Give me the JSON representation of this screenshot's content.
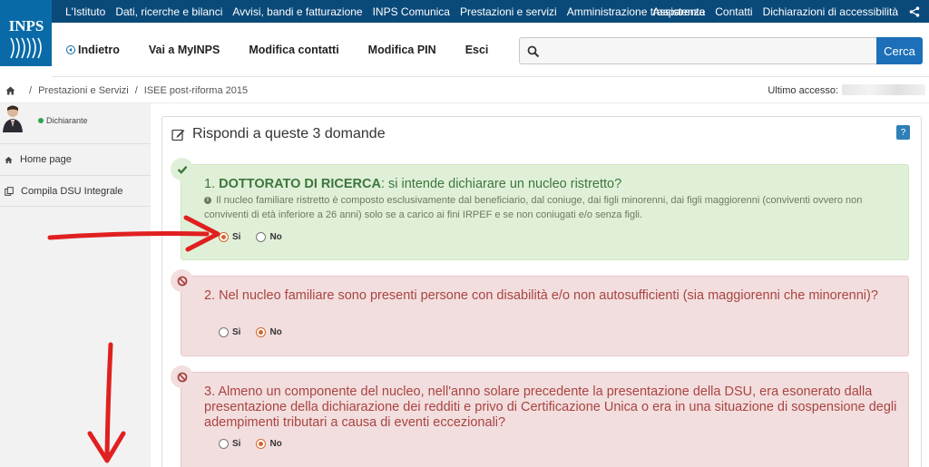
{
  "topbar": {
    "links": [
      "L'Istituto",
      "Dati, ricerche e bilanci",
      "Avvisi, bandi e fatturazione",
      "INPS Comunica",
      "Prestazioni e servizi",
      "Amministrazione trasparente"
    ],
    "right_links": [
      "Assistenza",
      "Contatti",
      "Dichiarazioni di accessibilità"
    ]
  },
  "logo": {
    "text": "INPS"
  },
  "nav": {
    "back": "Indietro",
    "myinps": "Vai a MyINPS",
    "modifica_contatti": "Modifica contatti",
    "modifica_pin": "Modifica PIN",
    "esci": "Esci"
  },
  "search": {
    "value": "",
    "button": "Cerca"
  },
  "breadcrumb": {
    "items": [
      "Prestazioni e Servizi",
      "ISEE post-riforma 2015"
    ],
    "last_access_label": "Ultimo accesso:"
  },
  "sidebar": {
    "status": "Dichiarante",
    "items": [
      "Home page",
      "Compila DSU Integrale"
    ]
  },
  "panel": {
    "title": "Rispondi a queste 3 domande",
    "help": "?"
  },
  "questions": [
    {
      "number": "1.",
      "strong": "DOTTORATO DI RICERCA",
      "text": ": si intende dichiarare un nucleo ristretto?",
      "note": "Il nucleo familiare ristretto è composto esclusivamente dal beneficiario, dal coniuge, dai figli minorenni, dai figli maggiorenni (conviventi ovvero non conviventi di età inferiore a 26 anni) solo se a carico ai fini IRPEF e se non coniugati e/o senza figli.",
      "options": [
        "Si",
        "No"
      ],
      "selected": "Si",
      "status": "valid"
    },
    {
      "text": "2. Nel nucleo familiare sono presenti persone con disabilità e/o non autosufficienti (sia maggiorenni che minorenni)?",
      "options": [
        "Si",
        "No"
      ],
      "selected": "No",
      "status": "invalid"
    },
    {
      "text": "3. Almeno un componente del nucleo, nell'anno solare precedente la presentazione della DSU, era esonerato dalla presentazione della dichiarazione dei redditi e privo di Certificazione Unica o era in una situazione di sospensione degli adempimenti tributari a causa di eventi eccezionali?",
      "options": [
        "Si",
        "No"
      ],
      "selected": "No",
      "status": "invalid"
    }
  ],
  "colors": {
    "topbar": "#0a4a7a",
    "logo": "#0a6aa8",
    "search_button": "#1c6fb8",
    "valid_bg": "#e0f0d8",
    "invalid_bg": "#f2dede",
    "annotation_arrow": "#e02020"
  }
}
